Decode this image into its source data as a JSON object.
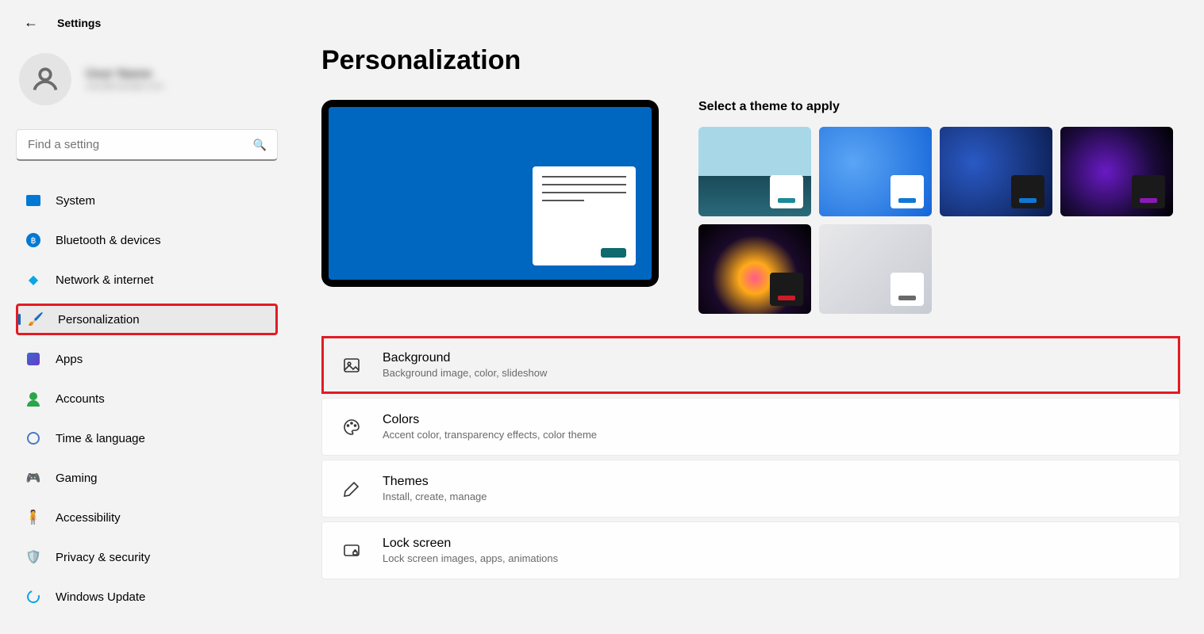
{
  "app_title": "Settings",
  "user": {
    "name": "User Name",
    "email": "user@example.com"
  },
  "search": {
    "placeholder": "Find a setting"
  },
  "nav": [
    {
      "id": "system",
      "label": "System"
    },
    {
      "id": "bluetooth",
      "label": "Bluetooth & devices"
    },
    {
      "id": "network",
      "label": "Network & internet"
    },
    {
      "id": "personalization",
      "label": "Personalization",
      "selected": true,
      "highlighted": true
    },
    {
      "id": "apps",
      "label": "Apps"
    },
    {
      "id": "accounts",
      "label": "Accounts"
    },
    {
      "id": "time",
      "label": "Time & language"
    },
    {
      "id": "gaming",
      "label": "Gaming"
    },
    {
      "id": "accessibility",
      "label": "Accessibility"
    },
    {
      "id": "privacy",
      "label": "Privacy & security"
    },
    {
      "id": "update",
      "label": "Windows Update"
    }
  ],
  "page": {
    "title": "Personalization",
    "themes_label": "Select a theme to apply"
  },
  "cards": [
    {
      "id": "background",
      "title": "Background",
      "desc": "Background image, color, slideshow",
      "highlighted": true
    },
    {
      "id": "colors",
      "title": "Colors",
      "desc": "Accent color, transparency effects, color theme"
    },
    {
      "id": "themes",
      "title": "Themes",
      "desc": "Install, create, manage"
    },
    {
      "id": "lockscreen",
      "title": "Lock screen",
      "desc": "Lock screen images, apps, animations"
    }
  ]
}
